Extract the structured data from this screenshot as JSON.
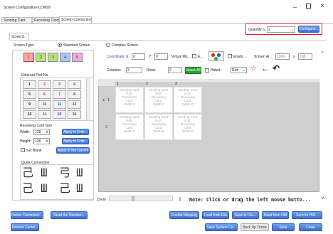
{
  "window": {
    "title": "Screen Configuration-COM99"
  },
  "tabs": [
    "Sending Card",
    "Receiving Card",
    "Screen Connection"
  ],
  "active_tab": 2,
  "quantity": {
    "label": "Quantity o...",
    "value": "1"
  },
  "configure_label": "Configure...",
  "subtab": "Screen1",
  "screen_type": {
    "label": "Screen Type:",
    "standard": "Standard Screen",
    "complex": "Complex Screen"
  },
  "color_buttons": [
    {
      "label": "1",
      "color": "#f4a6a6"
    },
    {
      "label": "2",
      "color": "#b8e07a"
    },
    {
      "label": "3",
      "color": "#b8e07a"
    },
    {
      "label": "4",
      "color": "#a6c8f4"
    },
    {
      "label": "5",
      "color": "#f4a6e8"
    }
  ],
  "ethernet": {
    "label": "Ethernet Port No.",
    "ports": [
      [
        "1",
        "2",
        "3",
        "4"
      ],
      [
        "5",
        "6",
        "7",
        "8"
      ],
      [
        "9",
        "10",
        "11",
        "12"
      ],
      [
        "13",
        "14",
        "15",
        "16"
      ]
    ],
    "port_colors": [
      "#111111",
      "#c0392b",
      "#1a4fb0",
      "#7a2a8a"
    ]
  },
  "rc_size": {
    "label": "Receiving Card Size",
    "width_label": "Width:",
    "width": "128",
    "height_label": "Height:",
    "height": "128",
    "apply_entire": "Apply to Entir...",
    "set_blank": "Set Blank",
    "apply_current": "Apply to the current"
  },
  "quick": {
    "label": "Quick Connection",
    "glyphs": [
      "己",
      "Ш",
      "弓",
      "Ш",
      "己",
      "Ш",
      "己",
      "Ш"
    ]
  },
  "coord": {
    "label": "Coordinate:",
    "x_label": "X:",
    "x": "0",
    "y_label": "Y:",
    "y": "0",
    "virtual": "Virtual Mo...",
    "e_label": "E...",
    "enable": "Enabl...",
    "screen_ar": "Screen Ar...",
    "ar_w": "1366",
    "ar_x": "x",
    "ar_h": "768"
  },
  "grid_ctrl": {
    "columns_label": "Columns",
    "columns": "3",
    "rows_label": "Rows",
    "rows": "2",
    "reset": "Reset-All",
    "hidden": "Hided...",
    "color": "Red"
  },
  "grid": {
    "col_headers": [
      "1",
      "2",
      "3"
    ],
    "row_headers": [
      "1",
      "2"
    ],
    "cell_lines": [
      "Sending Card:",
      "Port:",
      "Receiving",
      "Card:",
      "Width:0"
    ]
  },
  "zoom": {
    "label": "Zoom",
    "value": "1",
    "note": "Note: Click or drag the left mouse butto..."
  },
  "bottom_row1": {
    "left": [
      "Detect Communic...",
      "Read the Number..."
    ],
    "right": [
      "Enable Mapping",
      "Load from File",
      "Save to File...",
      "Read from HW",
      "Send to HW..."
    ]
  },
  "bottom_row2": {
    "left": "Restore Factor...",
    "save_system": "Save System Co...",
    "backup": "Back Up Terms",
    "save": "Save",
    "close": "Close"
  },
  "colors": {
    "accent": "#3f6fd0",
    "highlight_border": "#e02020",
    "grid_bg": "#cfcfcf"
  }
}
